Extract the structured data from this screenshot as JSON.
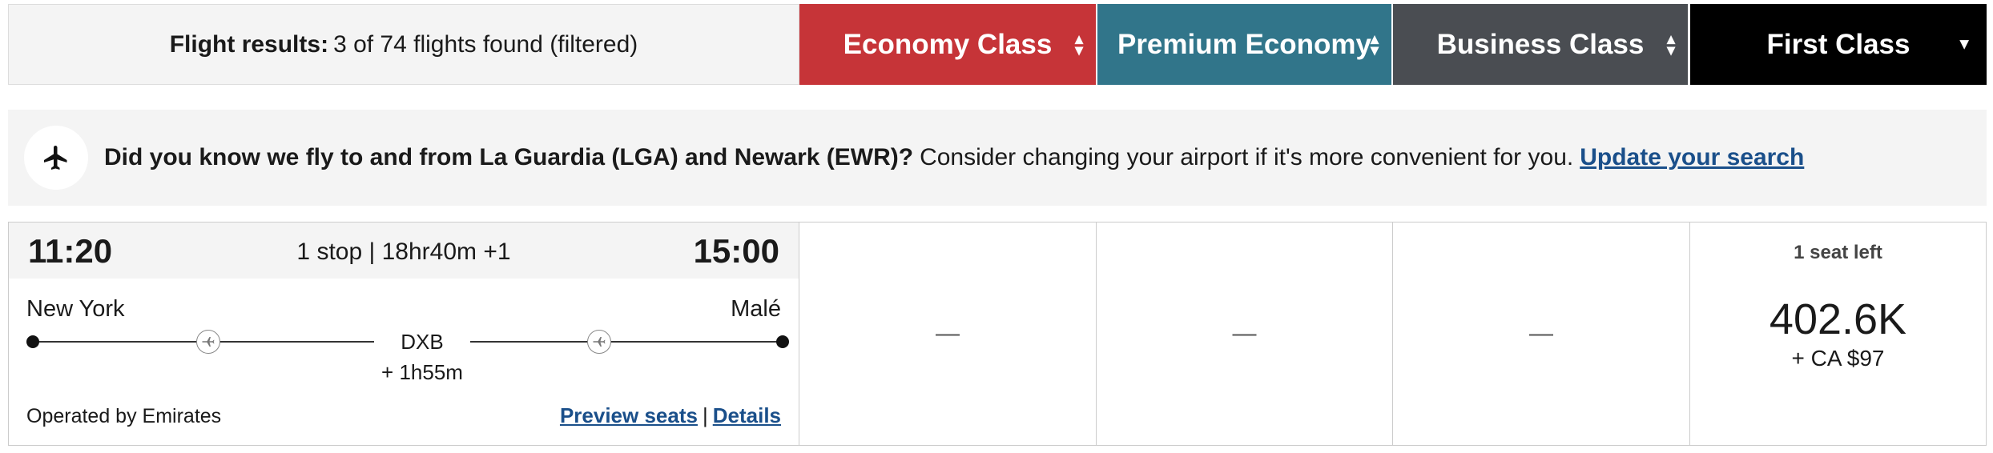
{
  "results": {
    "label": "Flight results:",
    "summary": "3 of 74 flights found (filtered)"
  },
  "tabs": [
    {
      "label": "Economy Class",
      "color": "#c63438",
      "icon": "sort-icon"
    },
    {
      "label": "Premium Economy",
      "color": "#31758a",
      "icon": "sort-icon"
    },
    {
      "label": "Business Class",
      "color": "#4a4d52",
      "icon": "sort-icon"
    },
    {
      "label": "First Class",
      "color": "#000000",
      "icon": "caret-down-icon"
    }
  ],
  "banner": {
    "icon": "airplane-icon",
    "bold_text": "Did you know we fly to and from La Guardia (LGA) and Newark (EWR)?",
    "text": "Consider changing your airport if it's more convenient for you.",
    "link": "Update your search"
  },
  "flight": {
    "departure_time": "11:20",
    "arrival_time": "15:00",
    "duration": "1 stop | 18hr40m +1",
    "origin": "New York",
    "destination": "Malé",
    "stop_code": "DXB",
    "layover": "+ 1h55m",
    "operated_by": "Operated by Emirates",
    "preview_seats": "Preview seats",
    "separator": "|",
    "details": "Details"
  },
  "fares": {
    "economy": "—",
    "premium": "—",
    "business": "—",
    "first": {
      "seats_left": "1 seat left",
      "price": "402.6K",
      "tax": "+ CA $97"
    }
  }
}
